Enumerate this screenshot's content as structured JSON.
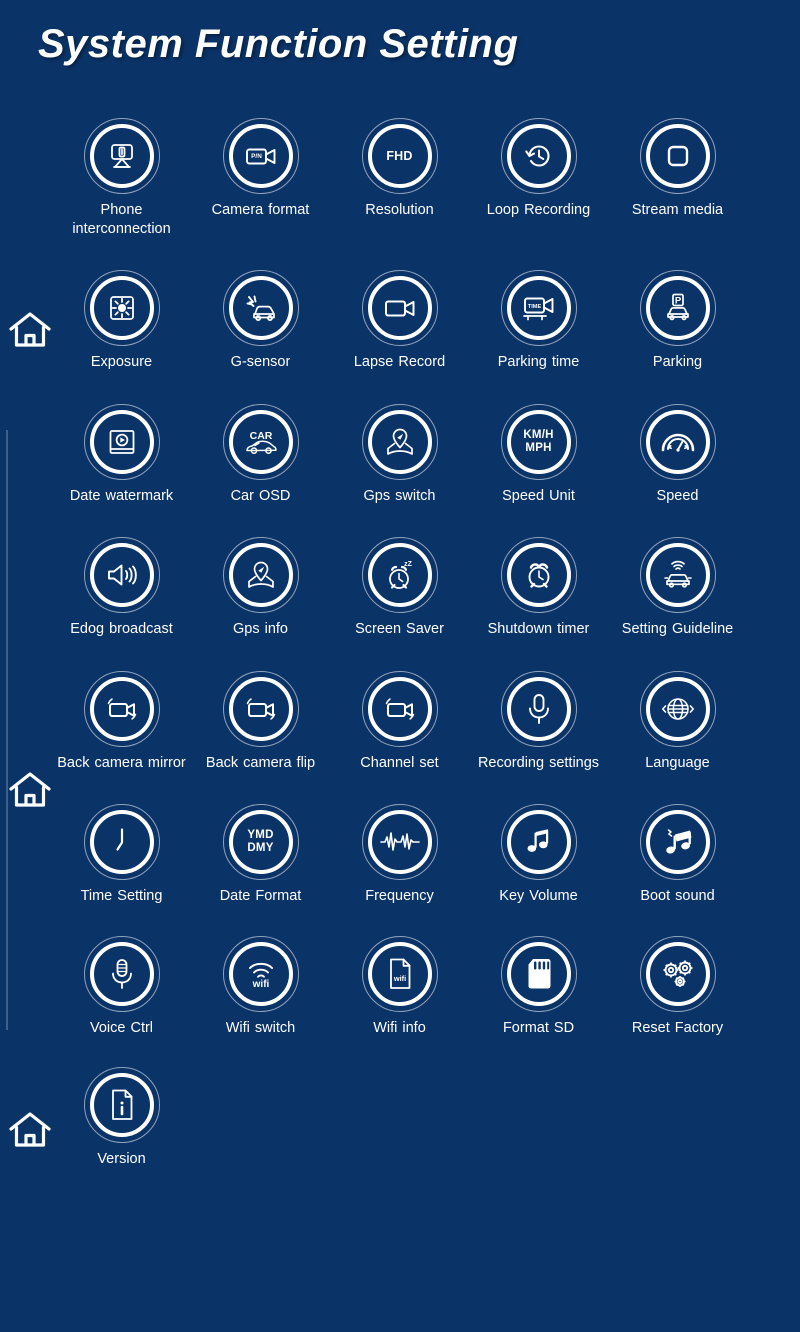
{
  "header": {
    "title": "System Function Setting"
  },
  "nav": {
    "home_label": "home-icon"
  },
  "rows": [
    {
      "items": [
        {
          "label": "Phone interconnection",
          "icon": "phone-interconnection-icon"
        },
        {
          "label": "Camera format",
          "icon": "camera-format-icon",
          "glyph_text": "P/N"
        },
        {
          "label": "Resolution",
          "icon": "resolution-icon",
          "glyph_text": "FHD"
        },
        {
          "label": "Loop Recording",
          "icon": "loop-recording-icon"
        },
        {
          "label": "Stream media",
          "icon": "stream-media-icon"
        }
      ]
    },
    {
      "items": [
        {
          "label": "Exposure",
          "icon": "exposure-icon"
        },
        {
          "label": "G-sensor",
          "icon": "g-sensor-icon"
        },
        {
          "label": "Lapse Record",
          "icon": "lapse-record-icon"
        },
        {
          "label": "Parking time",
          "icon": "parking-time-icon",
          "glyph_text": "TIME"
        },
        {
          "label": "Parking",
          "icon": "parking-icon",
          "glyph_text": "P"
        }
      ]
    },
    {
      "items": [
        {
          "label": "Date watermark",
          "icon": "date-watermark-icon"
        },
        {
          "label": "Car OSD",
          "icon": "car-osd-icon",
          "glyph_text": "CAR"
        },
        {
          "label": "Gps switch",
          "icon": "gps-switch-icon"
        },
        {
          "label": "Speed Unit",
          "icon": "speed-unit-icon",
          "glyph_text": "KM/H\nMPH"
        },
        {
          "label": "Speed",
          "icon": "speed-icon"
        }
      ]
    },
    {
      "items": [
        {
          "label": "Edog broadcast",
          "icon": "edog-broadcast-icon"
        },
        {
          "label": "Gps info",
          "icon": "gps-info-icon"
        },
        {
          "label": "Screen Saver",
          "icon": "screen-saver-icon"
        },
        {
          "label": "Shutdown timer",
          "icon": "shutdown-timer-icon"
        },
        {
          "label": "Setting Guideline",
          "icon": "setting-guideline-icon"
        }
      ]
    },
    {
      "items": [
        {
          "label": "Back camera mirror",
          "icon": "back-camera-mirror-icon"
        },
        {
          "label": "Back camera flip",
          "icon": "back-camera-flip-icon"
        },
        {
          "label": "Channel set",
          "icon": "channel-set-icon"
        },
        {
          "label": "Recording settings",
          "icon": "recording-settings-icon"
        },
        {
          "label": "Language",
          "icon": "language-icon"
        }
      ]
    },
    {
      "items": [
        {
          "label": "Time Setting",
          "icon": "time-setting-icon"
        },
        {
          "label": "Date Format",
          "icon": "date-format-icon",
          "glyph_text": "YMD\nDMY"
        },
        {
          "label": "Frequency",
          "icon": "frequency-icon"
        },
        {
          "label": "Key Volume",
          "icon": "key-volume-icon"
        },
        {
          "label": "Boot sound",
          "icon": "boot-sound-icon"
        }
      ]
    },
    {
      "items": [
        {
          "label": "Voice Ctrl",
          "icon": "voice-ctrl-icon"
        },
        {
          "label": "Wifi switch",
          "icon": "wifi-switch-icon",
          "glyph_text": "wifi"
        },
        {
          "label": "Wifi info",
          "icon": "wifi-info-icon",
          "glyph_text": "wifi"
        },
        {
          "label": "Format SD",
          "icon": "format-sd-icon"
        },
        {
          "label": "Reset Factory",
          "icon": "reset-factory-icon"
        }
      ]
    },
    {
      "items": [
        {
          "label": "Version",
          "icon": "version-icon"
        }
      ]
    }
  ],
  "colors": {
    "background": "#0a3368",
    "foreground": "#ffffff",
    "ring_outer": "rgba(255,255,255,0.55)"
  }
}
